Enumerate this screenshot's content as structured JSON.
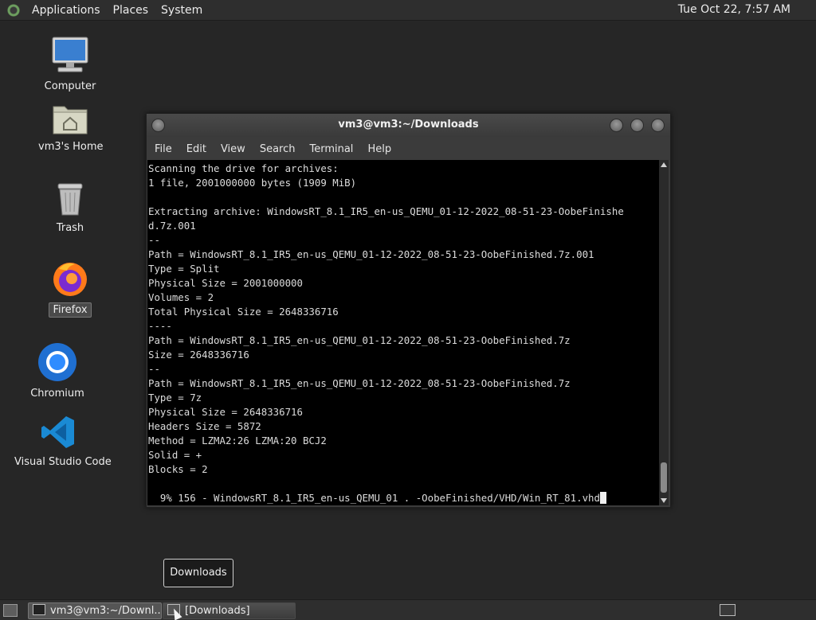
{
  "top_panel": {
    "menus": [
      "Applications",
      "Places",
      "System"
    ],
    "clock": "Tue Oct 22, 7:57 AM"
  },
  "desktop_icons": [
    {
      "label": "Computer",
      "icon": "computer-icon"
    },
    {
      "label": "vm3's Home",
      "icon": "home-folder-icon"
    },
    {
      "label": "Trash",
      "icon": "trash-icon"
    },
    {
      "label": "Firefox",
      "icon": "firefox-icon"
    },
    {
      "label": "Chromium",
      "icon": "chromium-icon"
    },
    {
      "label": "Visual Studio Code",
      "icon": "vscode-icon"
    }
  ],
  "terminal": {
    "title": "vm3@vm3:~/Downloads",
    "menu": [
      "File",
      "Edit",
      "View",
      "Search",
      "Terminal",
      "Help"
    ],
    "lines": [
      "Scanning the drive for archives:",
      "1 file, 2001000000 bytes (1909 MiB)",
      "",
      "Extracting archive: WindowsRT_8.1_IR5_en-us_QEMU_01-12-2022_08-51-23-OobeFinishe",
      "d.7z.001",
      "--",
      "Path = WindowsRT_8.1_IR5_en-us_QEMU_01-12-2022_08-51-23-OobeFinished.7z.001",
      "Type = Split",
      "Physical Size = 2001000000",
      "Volumes = 2",
      "Total Physical Size = 2648336716",
      "----",
      "Path = WindowsRT_8.1_IR5_en-us_QEMU_01-12-2022_08-51-23-OobeFinished.7z",
      "Size = 2648336716",
      "--",
      "Path = WindowsRT_8.1_IR5_en-us_QEMU_01-12-2022_08-51-23-OobeFinished.7z",
      "Type = 7z",
      "Physical Size = 2648336716",
      "Headers Size = 5872",
      "Method = LZMA2:26 LZMA:20 BCJ2",
      "Solid = +",
      "Blocks = 2",
      ""
    ],
    "progress_line": "  9% 156 - WindowsRT_8.1_IR5_en-us_QEMU_01 . -OobeFinished/VHD/Win_RT_81.vhd"
  },
  "tooltip": "Downloads",
  "taskbar": {
    "tasks": [
      {
        "label": "vm3@vm3:~/Downl...",
        "active": true
      },
      {
        "label": "[Downloads]",
        "active": false
      }
    ]
  }
}
